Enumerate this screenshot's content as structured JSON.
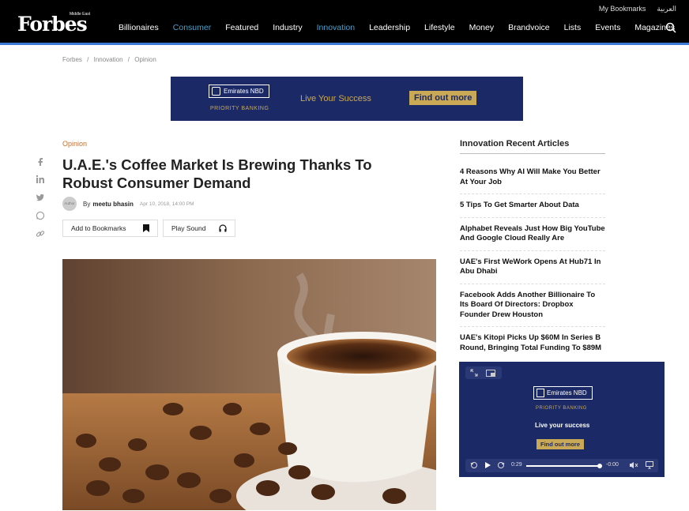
{
  "header": {
    "logo": "Forbes",
    "logo_sub": "Middle East",
    "top_links": [
      "My Bookmarks",
      "العربية"
    ],
    "nav": [
      {
        "label": "Billionaires",
        "highlight": false
      },
      {
        "label": "Consumer",
        "highlight": true
      },
      {
        "label": "Featured",
        "highlight": false
      },
      {
        "label": "Industry",
        "highlight": false
      },
      {
        "label": "Innovation",
        "highlight": true
      },
      {
        "label": "Leadership",
        "highlight": false
      },
      {
        "label": "Lifestyle",
        "highlight": false
      },
      {
        "label": "Money",
        "highlight": false
      },
      {
        "label": "Brandvoice",
        "highlight": false
      },
      {
        "label": "Lists",
        "highlight": false
      },
      {
        "label": "Events",
        "highlight": false
      },
      {
        "label": "Magazines",
        "highlight": false
      }
    ],
    "accent_color": "#4aa0c9"
  },
  "breadcrumb": [
    "Forbes",
    "/",
    "Innovation",
    "/",
    "Opinion"
  ],
  "ad_top": {
    "brand": "Emirates NBD",
    "subline": "PRIORITY BANKING",
    "tagline": "Live Your Success",
    "cta": "Find out more"
  },
  "social_icons": [
    "facebook-icon",
    "linkedin-icon",
    "twitter-icon",
    "whatsapp-icon",
    "link-icon"
  ],
  "article": {
    "category": "Opinion",
    "headline": "U.A.E.'s Coffee Market Is Brewing Thanks To Robust Consumer Demand",
    "avatar_text": "Author",
    "by": "By",
    "author": "meetu bhasin",
    "date": "Apr 10, 2018, 14:00 PM",
    "bookmark_label": "Add to Bookmarks",
    "sound_label": "Play Sound"
  },
  "sidebar": {
    "title": "Innovation Recent Articles",
    "items": [
      "4 Reasons Why AI Will Make You Better At Your Job",
      "5 Tips To Get Smarter About Data",
      "Alphabet Reveals Just How Big YouTube And Google Cloud Really Are",
      "UAE's First WeWork Opens At Hub71 In Abu Dhabi",
      "Facebook Adds Another Billionaire To Its Board Of Directors: Dropbox Founder Drew Houston",
      "UAE's Kitopi Picks Up $60M In Series B Round, Bringing Total Funding To $89M"
    ]
  },
  "video_ad": {
    "brand": "Emirates NBD",
    "subline": "PRIORITY BANKING",
    "tagline": "Live your success",
    "cta": "Find out more",
    "time_elapsed": "0:29",
    "time_remaining": "-0:00",
    "progress_fraction": 0.97
  }
}
